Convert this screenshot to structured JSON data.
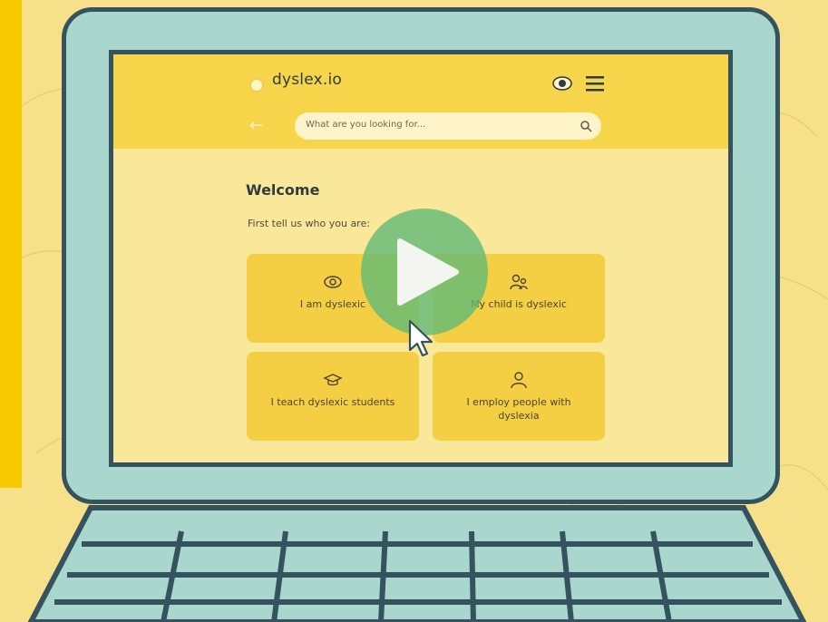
{
  "app": {
    "brand": "dyslex.io",
    "search": {
      "placeholder": "What are you looking for..."
    },
    "welcome_title": "Welcome",
    "intro_text": "First tell us who you are:",
    "cards": [
      {
        "label": "I am dyslexic",
        "icon": "eye-icon"
      },
      {
        "label": "My child is dyslexic",
        "icon": "parent-child-icon"
      },
      {
        "label": "I teach dyslexic students",
        "icon": "graduation-cap-icon"
      },
      {
        "label": "I employ people with dyslexia",
        "icon": "person-icon"
      }
    ]
  },
  "overlay": {
    "play_icon": "play-icon",
    "cursor_icon": "cursor-icon"
  },
  "colors": {
    "background": "#f7e08a",
    "accent": "#f5c800",
    "laptop_body": "#a9d6cd",
    "laptop_outline": "#34535e",
    "header": "#f7d54b",
    "card": "#f4cf43",
    "play": "#5eb976"
  }
}
